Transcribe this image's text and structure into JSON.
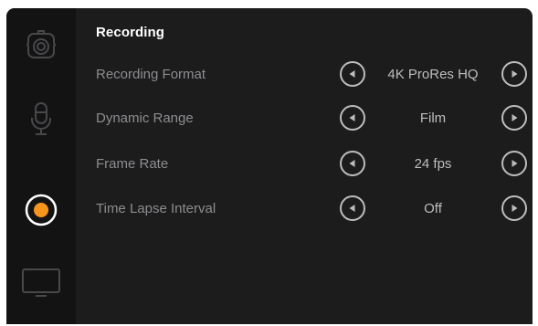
{
  "sidebar": {
    "tabs": [
      {
        "icon": "camera-icon",
        "active": false
      },
      {
        "icon": "microphone-icon",
        "active": false
      },
      {
        "icon": "record-icon",
        "active": true
      },
      {
        "icon": "monitor-icon",
        "active": false
      }
    ],
    "accent_color": "#f7941d"
  },
  "panel": {
    "title": "Recording",
    "settings": [
      {
        "label": "Recording Format",
        "value": "4K ProRes HQ"
      },
      {
        "label": "Dynamic Range",
        "value": "Film"
      },
      {
        "label": "Frame Rate",
        "value": "24 fps"
      },
      {
        "label": "Time Lapse Interval",
        "value": "Off"
      }
    ]
  }
}
